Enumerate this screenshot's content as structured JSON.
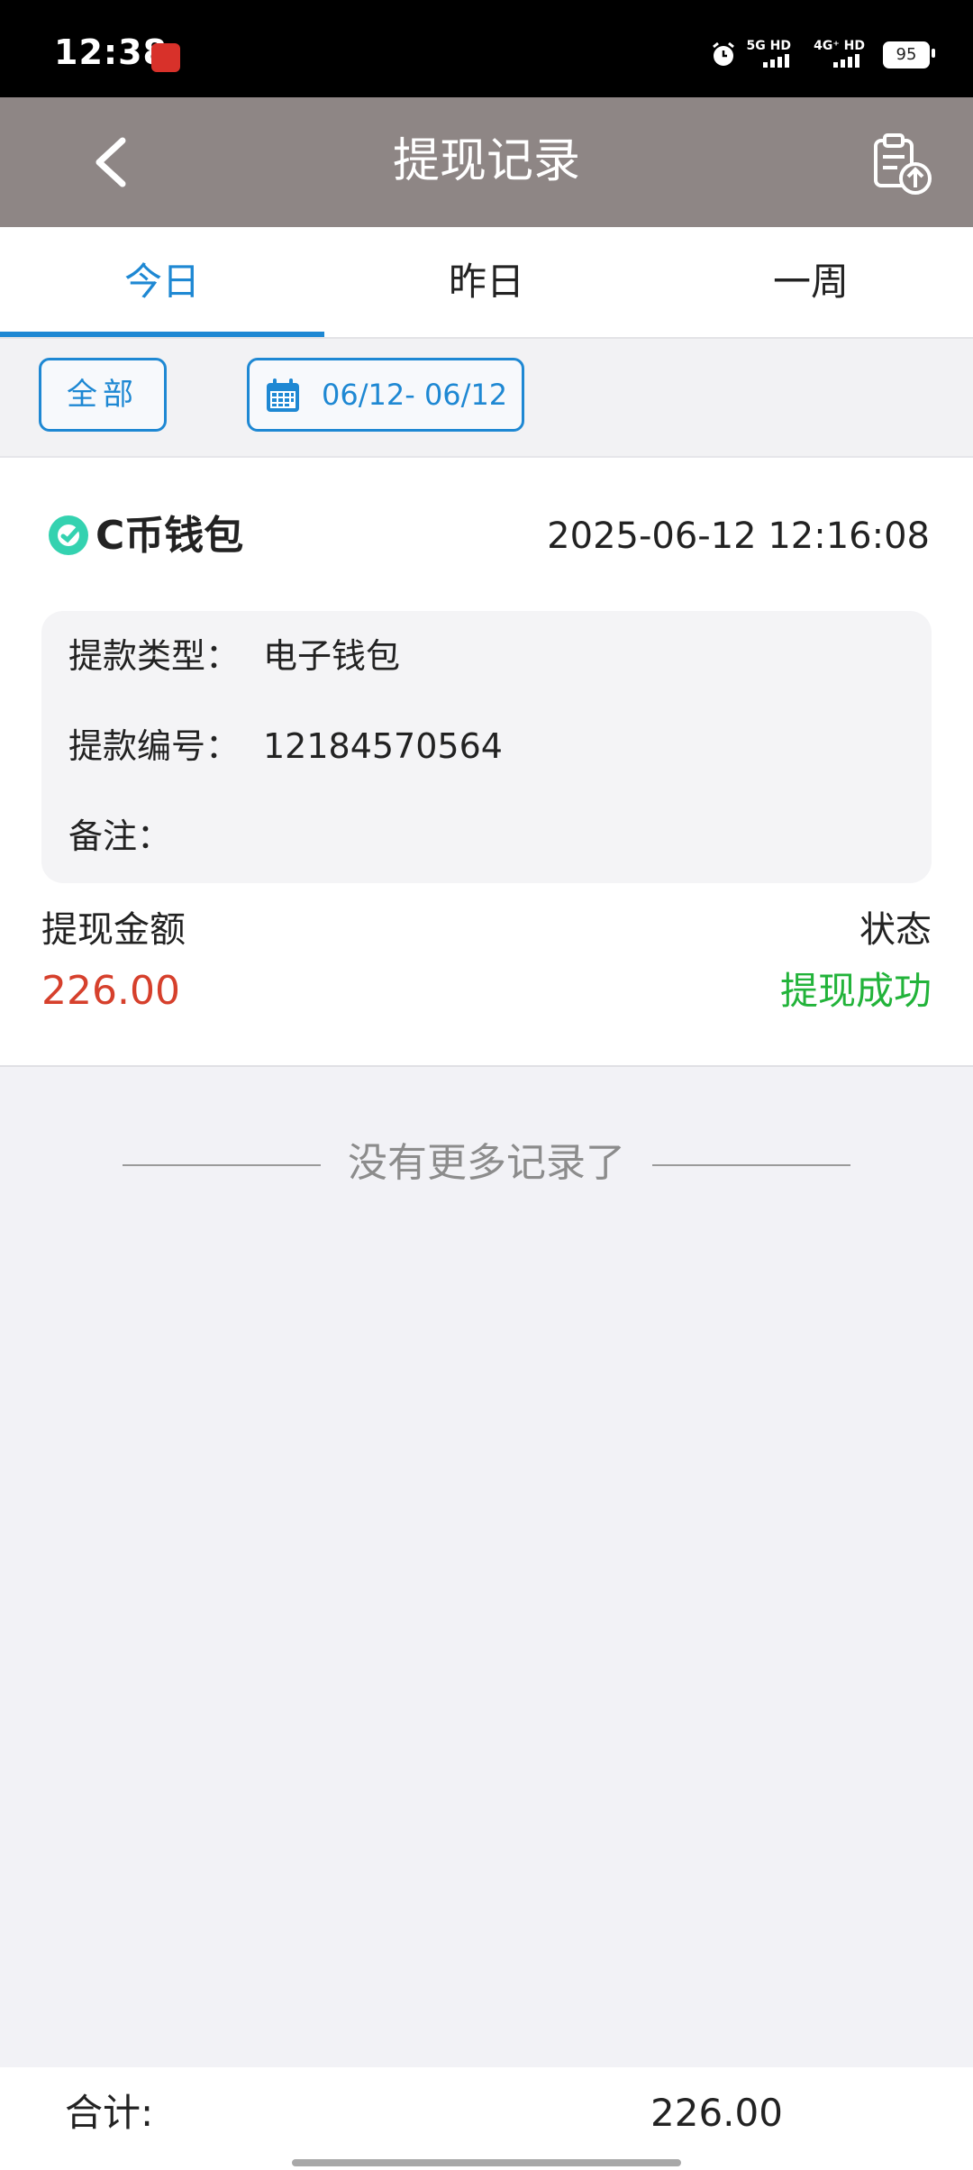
{
  "status_bar": {
    "time": "12:38",
    "net1": "5G HD",
    "net2": "4G⁺ HD",
    "battery": "95"
  },
  "nav": {
    "title": "提现记录",
    "back_icon": "chevron-left-icon",
    "export_icon": "clipboard-upload-icon"
  },
  "tabs": [
    {
      "label": "今日",
      "active": true
    },
    {
      "label": "昨日",
      "active": false
    },
    {
      "label": "一周",
      "active": false
    }
  ],
  "filters": {
    "all_label": "全部",
    "date_range": "06/12- 06/12"
  },
  "record": {
    "wallet_name": "C币钱包",
    "time": "2025-06-12 12:16:08",
    "type_label": "提款类型：",
    "type_value": "电子钱包",
    "number_label": "提款编号：",
    "number_value": "12184570564",
    "remark_label": "备注：",
    "amount_label": "提现金额",
    "amount_value": "226.00",
    "status_label": "状态",
    "status_value": "提现成功"
  },
  "no_more_text": "没有更多记录了",
  "footer": {
    "total_label": "合计:",
    "total_value": "226.00"
  },
  "colors": {
    "accent": "#1e88d3",
    "nav_bg": "#8e8685",
    "amount": "#d6402c",
    "success": "#22b33a"
  }
}
